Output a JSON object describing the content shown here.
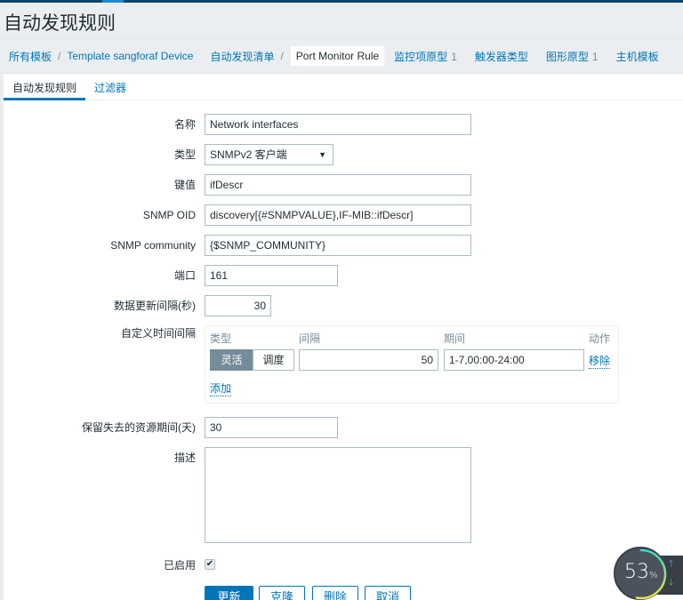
{
  "page": {
    "title": "自动发现规则"
  },
  "breadcrumb": {
    "items": [
      {
        "label": "所有模板"
      },
      {
        "label": "Template sangforaf Device"
      },
      {
        "label": "自动发现清单"
      },
      {
        "label": "Port Monitor Rule"
      },
      {
        "label": "监控项原型",
        "count": "1"
      },
      {
        "label": "触发器类型"
      },
      {
        "label": "图形原型",
        "count": "1"
      },
      {
        "label": "主机模板"
      }
    ]
  },
  "tabs": [
    {
      "label": "自动发现规则",
      "active": true
    },
    {
      "label": "过滤器",
      "active": false
    }
  ],
  "form": {
    "name": {
      "label": "名称",
      "value": "Network interfaces"
    },
    "type": {
      "label": "类型",
      "value": "SNMPv2 客户端"
    },
    "key": {
      "label": "键值",
      "value": "ifDescr"
    },
    "snmp_oid": {
      "label": "SNMP OID",
      "value": "discovery[{#SNMPVALUE},IF-MIB::ifDescr]"
    },
    "snmp_community": {
      "label": "SNMP community",
      "value": "{$SNMP_COMMUNITY}"
    },
    "port": {
      "label": "端口",
      "value": "161"
    },
    "update_interval": {
      "label": "数据更新间隔(秒)",
      "value": "30"
    },
    "custom_intervals": {
      "label": "自定义时间间隔",
      "headers": {
        "type": "类型",
        "interval": "间隔",
        "period": "期间",
        "action": "动作"
      },
      "rows": [
        {
          "type_flexible": "灵活",
          "type_scheduling": "调度",
          "selected": "灵活",
          "interval": "50",
          "period": "1-7,00:00-24:00",
          "remove": "移除"
        }
      ],
      "add": "添加"
    },
    "keep_lost": {
      "label": "保留失去的资源期间(天)",
      "value": "30"
    },
    "description": {
      "label": "描述",
      "value": ""
    },
    "enabled": {
      "label": "已启用",
      "checked": true
    }
  },
  "buttons": {
    "update": "更新",
    "clone": "克隆",
    "delete": "删除",
    "cancel": "取消"
  },
  "widget": {
    "percent": "53",
    "unit": "%",
    "progress": 0.53
  }
}
